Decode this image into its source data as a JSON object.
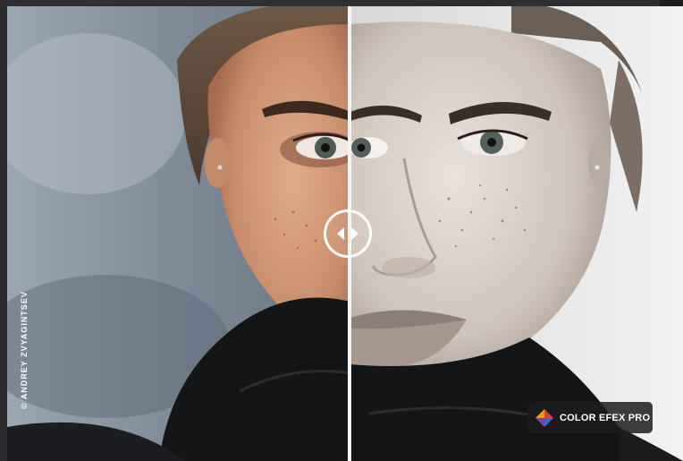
{
  "viewer": {
    "photo_credit": "© ANDREY ZVYAGINTSEV",
    "badge_label": "COLOR EFEX PRO",
    "badge_icon": "color-efex-logo-icon",
    "handle_icon": "left-right-arrows-icon"
  },
  "colors": {
    "divider": "#f4f4f4",
    "badge_bg": "#1c1c1e",
    "logo_red": "#e23b2e",
    "logo_orange": "#f39a1f",
    "logo_blue": "#2a6fd6",
    "logo_purple": "#7a3fb0"
  }
}
